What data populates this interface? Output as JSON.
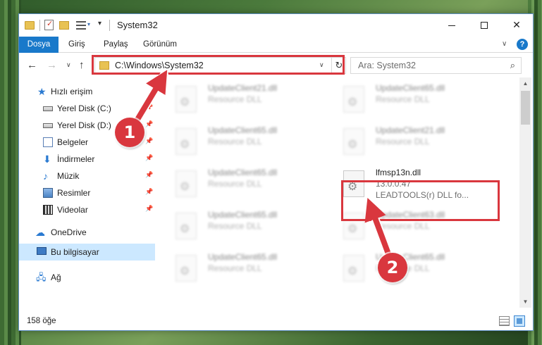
{
  "titlebar": {
    "title": "System32",
    "quick_access_customize": "▾",
    "minimize": "",
    "maximize": "",
    "close": "✕"
  },
  "ribbon": {
    "tabs": [
      "Dosya",
      "Giriş",
      "Paylaş",
      "Görünüm"
    ],
    "expand": "∨",
    "help": "?"
  },
  "nav": {
    "back": "←",
    "forward": "→",
    "recent": "∨",
    "up": "↑",
    "address": "C:\\Windows\\System32",
    "address_dropdown": "∨",
    "refresh": "↻",
    "search_placeholder": "Ara: System32"
  },
  "sidebar": {
    "items": [
      {
        "label": "Hızlı erişim",
        "icon": "star-icon",
        "pinned": false
      },
      {
        "label": "Yerel Disk (C:)",
        "icon": "drive-icon",
        "pinned": true
      },
      {
        "label": "Yerel Disk (D:)",
        "icon": "drive-icon",
        "pinned": true
      },
      {
        "label": "Belgeler",
        "icon": "documents-icon",
        "pinned": true
      },
      {
        "label": "İndirmeler",
        "icon": "download-icon",
        "pinned": true
      },
      {
        "label": "Müzik",
        "icon": "music-icon",
        "pinned": true
      },
      {
        "label": "Resimler",
        "icon": "pictures-icon",
        "pinned": true
      },
      {
        "label": "Videolar",
        "icon": "videos-icon",
        "pinned": true
      },
      {
        "label": "OneDrive",
        "icon": "cloud-icon",
        "pinned": false
      },
      {
        "label": "Bu bilgisayar",
        "icon": "computer-icon",
        "pinned": false,
        "selected": true
      },
      {
        "label": "Ağ",
        "icon": "network-icon",
        "pinned": false
      }
    ],
    "pin_glyph": "📌"
  },
  "files": [
    {
      "name": "UpdateClient21.dll",
      "desc": "Resource DLL",
      "blurred": true
    },
    {
      "name": "UpdateClient65.dll",
      "desc": "Resource DLL",
      "blurred": true
    },
    {
      "name": "UpdateClient65.dll",
      "desc": "Resource DLL",
      "blurred": true
    },
    {
      "name": "UpdateClient21.dll",
      "desc": "Resource DLL",
      "blurred": true
    },
    {
      "name": "UpdateClient65.dll",
      "desc": "Resource DLL",
      "blurred": true
    },
    {
      "name": "lfmsp13n.dll",
      "version": "13.0.0.47",
      "desc": "LEADTOOLS(r) DLL fo...",
      "blurred": false,
      "highlighted": true
    },
    {
      "name": "UpdateClient65.dll",
      "desc": "Resource DLL",
      "blurred": true
    },
    {
      "name": "UpdateClient63.dll",
      "desc": "Resource DLL",
      "blurred": true
    },
    {
      "name": "UpdateClient65.dll",
      "desc": "Resource DLL",
      "blurred": true
    },
    {
      "name": "UpdateClient65.dll",
      "desc": "Resource DLL",
      "blurred": true
    }
  ],
  "scrollbar": {
    "up": "▲",
    "down": "▼"
  },
  "status": {
    "item_count": "158 öğe"
  },
  "annotations": {
    "badge_1": "1",
    "badge_2": "2",
    "color": "#d9373e"
  },
  "colors": {
    "accent": "#1979ca",
    "selection": "#cce8ff",
    "highlight": "#d9373e"
  }
}
